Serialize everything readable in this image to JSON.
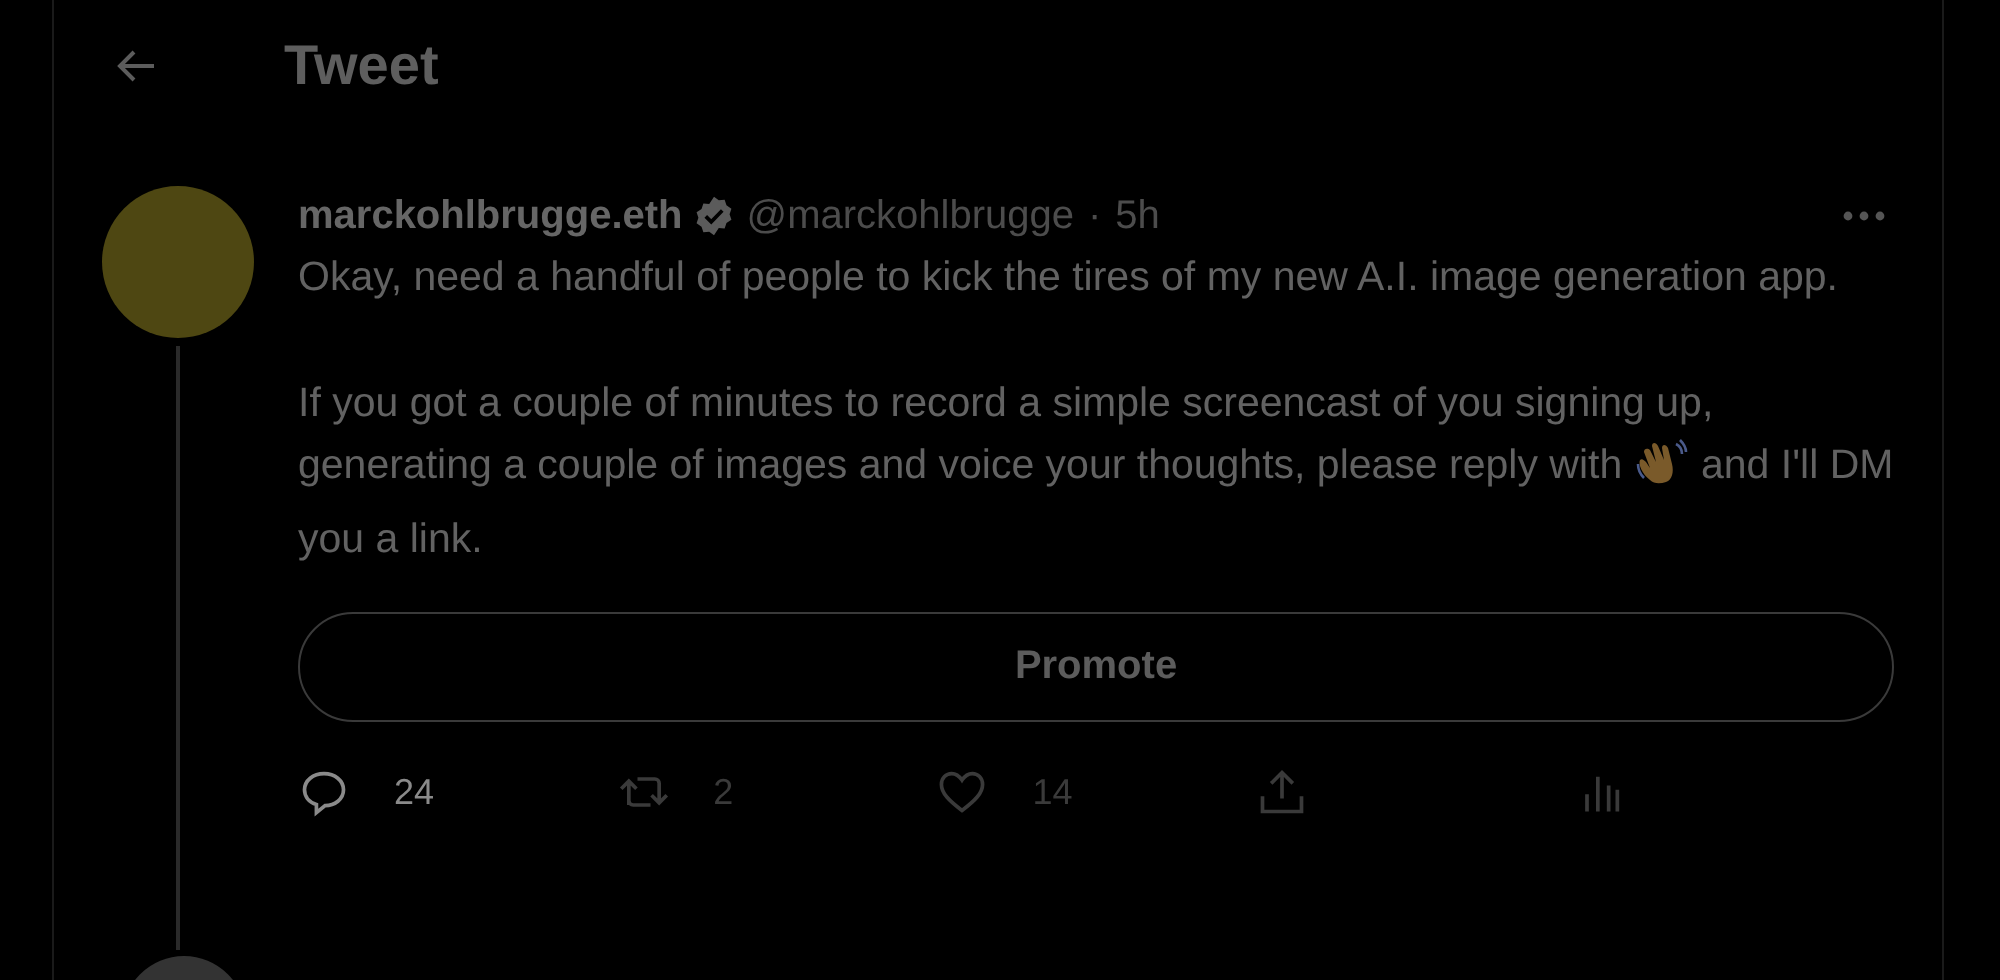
{
  "header": {
    "title": "Tweet"
  },
  "tweet": {
    "display_name": "marckohlbrugge.eth",
    "verified": true,
    "handle": "@marckohlbrugge",
    "separator": "·",
    "time": "5h",
    "paragraphs": [
      {
        "text": "Okay, need a handful of people to kick the tires of my new A.I. image generation app."
      },
      {
        "text": "If you got a couple of minutes to record a simple screencast of you signing up, generating a couple of images and voice your thoughts, please reply with",
        "text_after": "and I'll DM you a link."
      }
    ],
    "promote_button": "Promote",
    "actions": [
      {
        "kind": "reply",
        "count": "24",
        "highlighted": true
      },
      {
        "kind": "retweet",
        "count": "2",
        "highlighted": false
      },
      {
        "kind": "like",
        "count": "14",
        "highlighted": false
      },
      {
        "kind": "share",
        "highlighted": false
      },
      {
        "kind": "analytics",
        "highlighted": false
      }
    ]
  }
}
